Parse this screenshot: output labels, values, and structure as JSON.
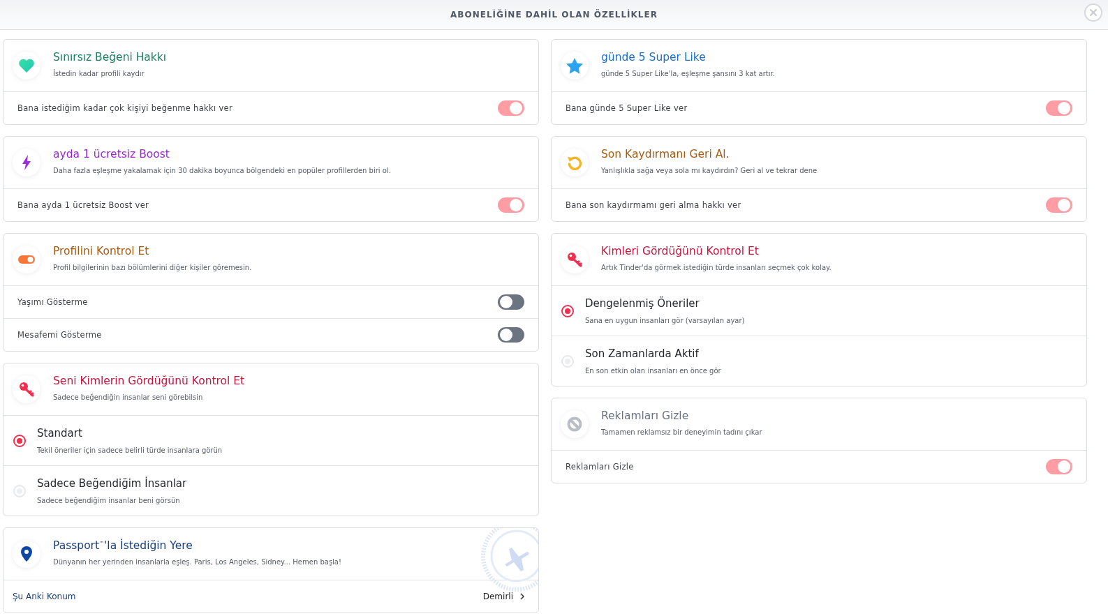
{
  "header": {
    "title": "ABONELİĞİNE DAHİL OLAN ÖZELLİKLER"
  },
  "columns": [
    {
      "cards": [
        {
          "title": "Sınırsız Beğeni Hakkı",
          "color": "#1a7d5c",
          "description": "İstedin kadar profili kaydır",
          "rows": [
            {
              "kind": "toggle",
              "label": "Bana istediğim kadar çok kişiyi beğenme hakkı ver",
              "on": true
            }
          ]
        },
        {
          "title": "ayda 1 ücretsiz Boost",
          "color": "#9b26d6",
          "description": "Daha fazla eşleşme yakalamak için 30 dakika boyunca bölgendeki en popüler profillerden biri ol.",
          "rows": [
            {
              "kind": "toggle",
              "label": "Bana ayda 1 ücretsiz Boost ver",
              "on": true
            }
          ]
        },
        {
          "title": "Profilini Kontrol Et",
          "color": "#a65a10",
          "description": "Profil bilgilerinin bazı bölümlerini diğer kişiler göremesin.",
          "rows": [
            {
              "kind": "toggle",
              "label": "Yaşımı Gösterme",
              "on": false
            },
            {
              "kind": "toggle",
              "label": "Mesafemi Gösterme",
              "on": false
            }
          ]
        },
        {
          "title": "Seni Kimlerin Gördüğünü Kontrol Et",
          "color": "#c8143c",
          "description": "Sadece beğendiğin insanlar seni görebilsin",
          "rows": [
            {
              "kind": "radio",
              "label": "Standart",
              "description": "Tekil öneriler için sadece belirli türde insanlara görün",
              "selected": true
            },
            {
              "kind": "radio",
              "label": "Sadece Beğendiğim İnsanlar",
              "description": "Sadece beğendiğim insanlar beni görsün",
              "selected": false
            }
          ]
        },
        {
          "title": "Passport$^{™}$'la İstediğin Yere",
          "color": "#1b3f7a",
          "description": "Dünyanın her yerinden insanlarla eşleş. Paris, Los Angeles, Sidney... Hemen başla!",
          "rows": [
            {
              "kind": "location",
              "label": "Şu Anki Konum",
              "value": "Demirli"
            }
          ]
        }
      ]
    },
    {
      "cards": [
        {
          "title": "günde 5 Super Like",
          "color": "#1b6fc8",
          "description": "günde 5 Super Like'la, eşleşme şansını 3 kat artır.",
          "rows": [
            {
              "kind": "toggle",
              "label": "Bana günde 5 Super Like ver",
              "on": true
            }
          ]
        },
        {
          "title": "Son Kaydırmanı Geri Al.",
          "color": "#a65a10",
          "description": "Yanlışlıkla sağa veya sola mı kaydırdın? Geri al ve tekrar dene",
          "rows": [
            {
              "kind": "toggle",
              "label": "Bana son kaydırmamı geri alma hakkı ver",
              "on": true
            }
          ]
        },
        {
          "title": "Kimleri Gördüğünü Kontrol Et",
          "color": "#c8143c",
          "description": "Artık Tinder'da görmek istediğin türde insanları seçmek çok kolay.",
          "rows": [
            {
              "kind": "radio",
              "label": "Dengelenmiş Öneriler",
              "description": "Sana en uygun insanları gör (varsayılan ayar)",
              "selected": true
            },
            {
              "kind": "radio",
              "label": "Son Zamanlarda Aktif",
              "description": "En son etkin olan insanları en önce gör",
              "selected": false
            }
          ]
        },
        {
          "title": "Reklamları Gizle",
          "color": "#6b7480",
          "description": "Tamamen reklamsız bir deneyimin tadını çıkar",
          "rows": [
            {
              "kind": "toggle",
              "label": "Reklamları Gizle",
              "on": true
            }
          ]
        }
      ]
    }
  ]
}
